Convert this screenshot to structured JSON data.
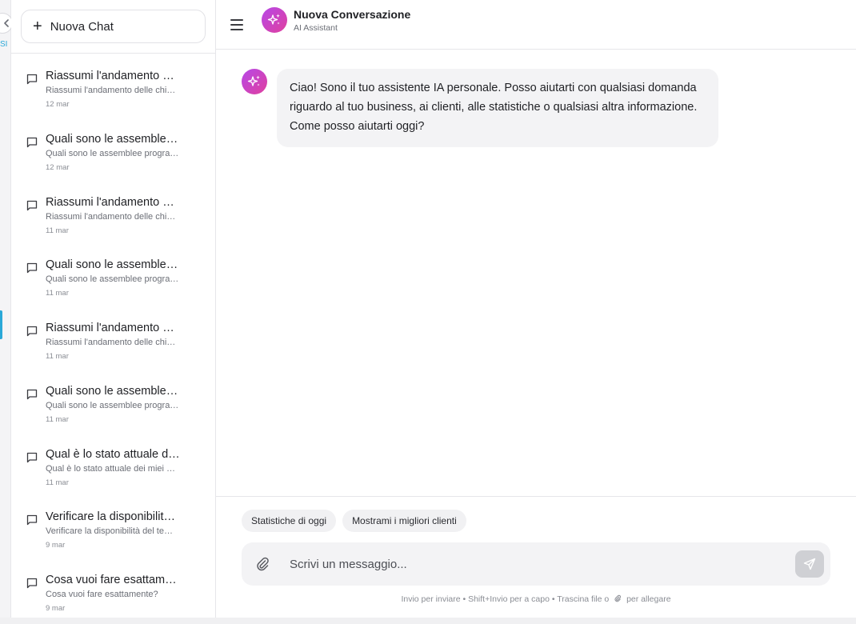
{
  "edge": {
    "label": "SI"
  },
  "sidebar": {
    "new_chat_label": "Nuova Chat",
    "chats": [
      {
        "title": "Riassumi l'andamento d…",
        "preview": "Riassumi l'andamento delle chi…",
        "date": "12 mar"
      },
      {
        "title": "Quali sono le assemblee…",
        "preview": "Quali sono le assemblee progra…",
        "date": "12 mar"
      },
      {
        "title": "Riassumi l'andamento d…",
        "preview": "Riassumi l'andamento delle chi…",
        "date": "11 mar"
      },
      {
        "title": "Quali sono le assemblee…",
        "preview": "Quali sono le assemblee progra…",
        "date": "11 mar"
      },
      {
        "title": "Riassumi l'andamento d…",
        "preview": "Riassumi l'andamento delle chi…",
        "date": "11 mar"
      },
      {
        "title": "Quali sono le assemblee…",
        "preview": "Quali sono le assemblee progra…",
        "date": "11 mar"
      },
      {
        "title": "Qual è lo stato attuale d…",
        "preview": "Qual è lo stato attuale dei miei …",
        "date": "11 mar"
      },
      {
        "title": "Verificare la disponibilità…",
        "preview": "Verificare la disponibilità del te…",
        "date": "9 mar"
      },
      {
        "title": "Cosa vuoi fare esattame…",
        "preview": "Cosa vuoi fare esattamente?",
        "date": "9 mar"
      }
    ]
  },
  "header": {
    "title": "Nuova Conversazione",
    "subtitle": "AI Assistant"
  },
  "messages": [
    {
      "role": "assistant",
      "text": "Ciao! Sono il tuo assistente IA personale. Posso aiutarti con qualsiasi domanda riguardo al tuo business, ai clienti, alle statistiche o qualsiasi altra informazione. Come posso aiutarti oggi?"
    }
  ],
  "composer": {
    "suggestions": [
      "Statistiche di oggi",
      "Mostrami i migliori clienti"
    ],
    "placeholder": "Scrivi un messaggio...",
    "hint_prefix": "Invio per inviare • Shift+Invio per a capo • Trascina file o",
    "hint_suffix": "per allegare"
  },
  "colors": {
    "accent_gradient_start": "#b648e8",
    "accent_gradient_end": "#e0409e",
    "nav_accent": "#2aa8d8",
    "send_button_disabled": "#cfd0d4"
  }
}
